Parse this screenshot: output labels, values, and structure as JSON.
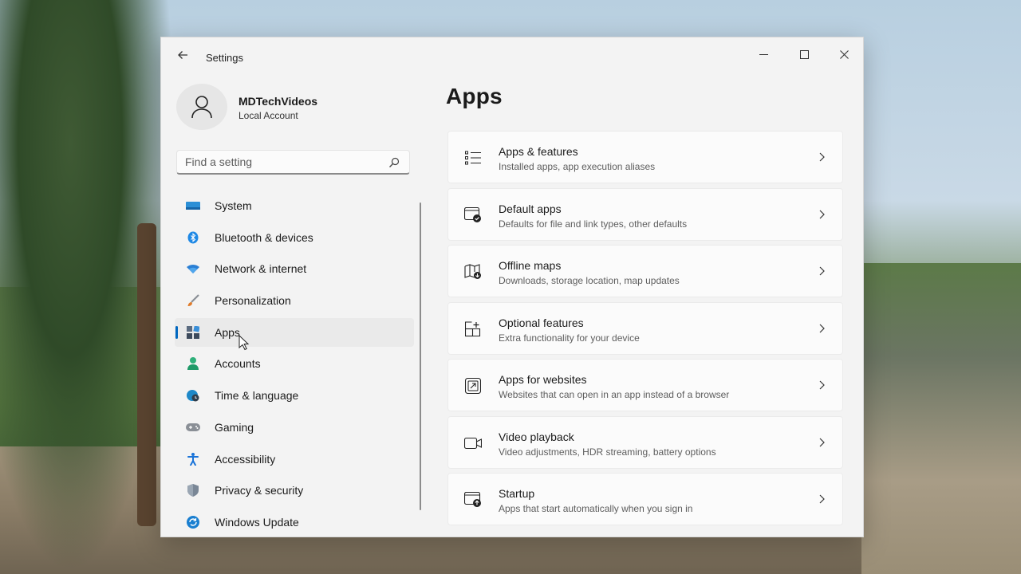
{
  "window": {
    "title": "Settings"
  },
  "profile": {
    "name": "MDTechVideos",
    "account_type": "Local Account"
  },
  "search": {
    "placeholder": "Find a setting"
  },
  "sidebar": {
    "items": [
      {
        "label": "System",
        "icon": "monitor-icon",
        "color": "#1e88c8"
      },
      {
        "label": "Bluetooth & devices",
        "icon": "bluetooth-icon",
        "color": "#1e88e5"
      },
      {
        "label": "Network & internet",
        "icon": "wifi-icon",
        "color": "#2a7fd4"
      },
      {
        "label": "Personalization",
        "icon": "brush-icon",
        "color": "#c96b2a"
      },
      {
        "label": "Apps",
        "icon": "apps-icon",
        "color": "#4a5a70",
        "active": true
      },
      {
        "label": "Accounts",
        "icon": "person-icon",
        "color": "#2fb07a"
      },
      {
        "label": "Time & language",
        "icon": "globe-clock-icon",
        "color": "#1e88c8"
      },
      {
        "label": "Gaming",
        "icon": "gamepad-icon",
        "color": "#7a7a7a"
      },
      {
        "label": "Accessibility",
        "icon": "accessibility-icon",
        "color": "#1a73d8"
      },
      {
        "label": "Privacy & security",
        "icon": "shield-icon",
        "color": "#6c7a88"
      },
      {
        "label": "Windows Update",
        "icon": "update-icon",
        "color": "#1a7fd0"
      }
    ]
  },
  "main": {
    "title": "Apps",
    "cards": [
      {
        "title": "Apps & features",
        "subtitle": "Installed apps, app execution aliases",
        "icon": "list-icon"
      },
      {
        "title": "Default apps",
        "subtitle": "Defaults for file and link types, other defaults",
        "icon": "default-apps-icon"
      },
      {
        "title": "Offline maps",
        "subtitle": "Downloads, storage location, map updates",
        "icon": "map-icon"
      },
      {
        "title": "Optional features",
        "subtitle": "Extra functionality for your device",
        "icon": "add-grid-icon"
      },
      {
        "title": "Apps for websites",
        "subtitle": "Websites that can open in an app instead of a browser",
        "icon": "open-external-icon"
      },
      {
        "title": "Video playback",
        "subtitle": "Video adjustments, HDR streaming, battery options",
        "icon": "video-icon"
      },
      {
        "title": "Startup",
        "subtitle": "Apps that start automatically when you sign in",
        "icon": "startup-icon"
      }
    ]
  },
  "accent_color": "#0067c0"
}
